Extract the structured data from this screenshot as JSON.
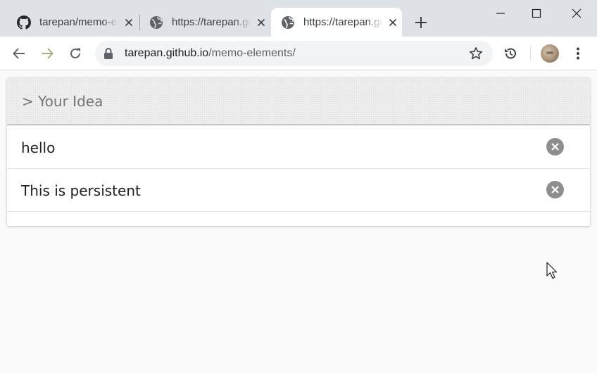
{
  "browser": {
    "tabs": [
      {
        "title": "tarepan/memo-elements",
        "favicon": "github-icon",
        "active": false
      },
      {
        "title": "https://tarepan.github.io/memo-elements/",
        "favicon": "globe-icon",
        "active": false
      },
      {
        "title": "https://tarepan.github.io/memo-elements/",
        "favicon": "globe-icon",
        "active": true
      }
    ],
    "url": {
      "host": "tarepan.github.io",
      "path": "/memo-elements/"
    }
  },
  "page": {
    "input_placeholder": "> Your Idea",
    "memos": [
      {
        "text": "hello"
      },
      {
        "text": "This is persistent"
      }
    ]
  },
  "colors": {
    "tabstrip": "#dee1e6",
    "omnibox": "#f1f3f4",
    "delete_button": "#8e8e8e",
    "input_underline": "#8a8a8a"
  }
}
